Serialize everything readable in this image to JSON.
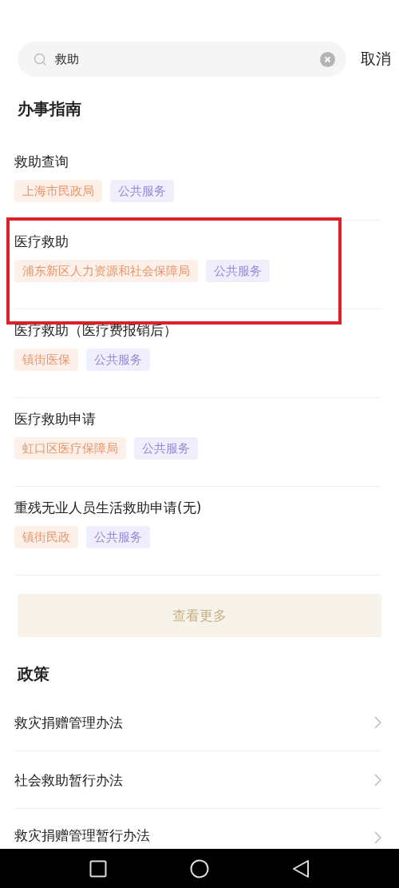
{
  "search": {
    "value": "救助",
    "cancel": "取消"
  },
  "guide": {
    "heading": "办事指南",
    "items": [
      {
        "title": "救助查询",
        "highlighted": false,
        "tags": [
          {
            "kind": "org",
            "label": "上海市民政局"
          },
          {
            "kind": "service",
            "label": "公共服务"
          }
        ]
      },
      {
        "title": "医疗救助",
        "highlighted": true,
        "tags": [
          {
            "kind": "org",
            "label": "浦东新区人力资源和社会保障局"
          },
          {
            "kind": "service",
            "label": "公共服务"
          }
        ]
      },
      {
        "title": "医疗救助（医疗费报销后）",
        "highlighted": false,
        "tags": [
          {
            "kind": "org",
            "label": "镇街医保"
          },
          {
            "kind": "service",
            "label": "公共服务"
          }
        ]
      },
      {
        "title": "医疗救助申请",
        "highlighted": false,
        "tags": [
          {
            "kind": "org",
            "label": "虹口区医疗保障局"
          },
          {
            "kind": "service",
            "label": "公共服务"
          }
        ]
      },
      {
        "title": "重残无业人员生活救助申请(无)",
        "highlighted": false,
        "tags": [
          {
            "kind": "org",
            "label": "镇街民政"
          },
          {
            "kind": "service",
            "label": "公共服务"
          }
        ]
      }
    ],
    "more": "查看更多"
  },
  "policy": {
    "heading": "政策",
    "items": [
      "救灾捐赠管理办法",
      "社会救助暂行办法",
      "救灾捐赠管理暂行办法"
    ]
  }
}
